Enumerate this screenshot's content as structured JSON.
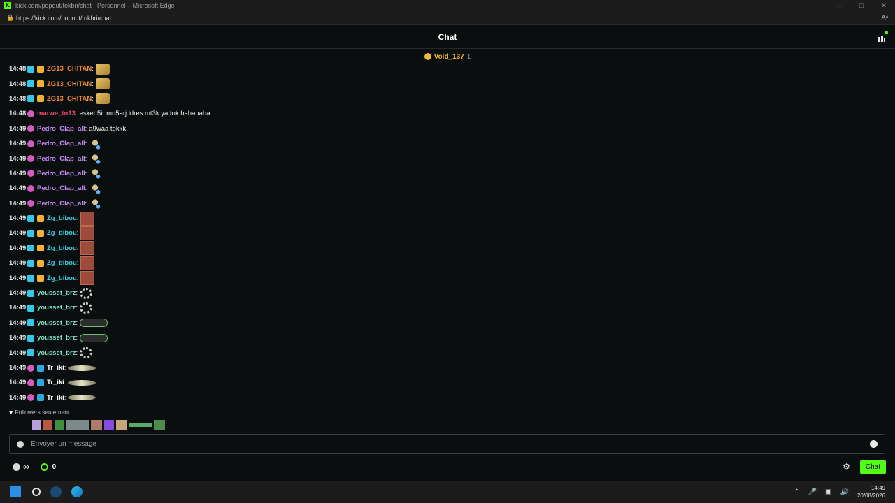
{
  "window": {
    "title": "kick.com/popout/tokbri/chat - Personnel – Microsoft Edge",
    "url": "https://kick.com/popout/tokbri/chat",
    "min": "—",
    "max": "□",
    "close": "✕",
    "read_aloud": "Aᵃ"
  },
  "header": {
    "title": "Chat"
  },
  "pinned": {
    "name": "Void_137",
    "count": "1"
  },
  "messages": [
    {
      "time": "14:48",
      "badges": [
        "sub",
        "crown"
      ],
      "user": "ZG13_CHITAN",
      "color": "#f08a3c",
      "text": "",
      "emote": "gold"
    },
    {
      "time": "14:48",
      "badges": [
        "sub",
        "crown"
      ],
      "user": "ZG13_CHITAN",
      "color": "#f08a3c",
      "text": "",
      "emote": "gold"
    },
    {
      "time": "14:48",
      "badges": [
        "sub",
        "crown"
      ],
      "user": "ZG13_CHITAN",
      "color": "#f08a3c",
      "text": "",
      "emote": "gold"
    },
    {
      "time": "14:48",
      "badges": [
        "pink"
      ],
      "user": "marwe_tn13",
      "color": "#e84a6b",
      "text": "esket 5ir mn5arj ldres mt3k ya tok hahahaha",
      "emote": ""
    },
    {
      "time": "14:49",
      "badges": [
        "pink"
      ],
      "user": "Pedro_Clap_all",
      "color": "#c58af9",
      "text": "a9waa tokkk",
      "emote": ""
    },
    {
      "time": "14:49",
      "badges": [
        "pink"
      ],
      "user": "Pedro_Clap_all",
      "color": "#c58af9",
      "text": "",
      "emote": "small"
    },
    {
      "time": "14:49",
      "badges": [
        "pink"
      ],
      "user": "Pedro_Clap_all",
      "color": "#c58af9",
      "text": "",
      "emote": "small"
    },
    {
      "time": "14:49",
      "badges": [
        "pink"
      ],
      "user": "Pedro_Clap_all",
      "color": "#c58af9",
      "text": "",
      "emote": "small"
    },
    {
      "time": "14:49",
      "badges": [
        "pink"
      ],
      "user": "Pedro_Clap_all",
      "color": "#c58af9",
      "text": "",
      "emote": "small"
    },
    {
      "time": "14:49",
      "badges": [
        "pink"
      ],
      "user": "Pedro_Clap_all",
      "color": "#c58af9",
      "text": "",
      "emote": "small"
    },
    {
      "time": "14:49",
      "badges": [
        "sub",
        "crown"
      ],
      "user": "Zg_bibou",
      "color": "#3ad1e6",
      "text": "",
      "emote": "red"
    },
    {
      "time": "14:49",
      "badges": [
        "sub",
        "crown"
      ],
      "user": "Zg_bibou",
      "color": "#3ad1e6",
      "text": "",
      "emote": "red"
    },
    {
      "time": "14:49",
      "badges": [
        "sub",
        "crown"
      ],
      "user": "Zg_bibou",
      "color": "#3ad1e6",
      "text": "",
      "emote": "red"
    },
    {
      "time": "14:49",
      "badges": [
        "sub",
        "crown"
      ],
      "user": "Zg_bibou",
      "color": "#3ad1e6",
      "text": "",
      "emote": "red"
    },
    {
      "time": "14:49",
      "badges": [
        "sub",
        "crown"
      ],
      "user": "Zg_bibou",
      "color": "#3ad1e6",
      "text": "",
      "emote": "red"
    },
    {
      "time": "14:49",
      "badges": [
        "sub"
      ],
      "user": "youssef_brz",
      "color": "#7fe0c4",
      "text": "",
      "emote": "spin"
    },
    {
      "time": "14:49",
      "badges": [
        "sub"
      ],
      "user": "youssef_brz",
      "color": "#7fe0c4",
      "text": "",
      "emote": "spin"
    },
    {
      "time": "14:49",
      "badges": [
        "sub"
      ],
      "user": "youssef_brz",
      "color": "#7fe0c4",
      "text": "",
      "emote": "eyes"
    },
    {
      "time": "14:49",
      "badges": [
        "sub"
      ],
      "user": "youssef_brz",
      "color": "#7fe0c4",
      "text": "",
      "emote": "eyes"
    },
    {
      "time": "14:49",
      "badges": [
        "sub"
      ],
      "user": "youssef_brz",
      "color": "#7fe0c4",
      "text": "",
      "emote": "spin"
    },
    {
      "time": "14:49",
      "badges": [
        "pink",
        "arrow"
      ],
      "user": "Tr_iki",
      "color": "#ffffff",
      "text": "",
      "emote": "wing"
    },
    {
      "time": "14:49",
      "badges": [
        "pink",
        "arrow"
      ],
      "user": "Tr_iki",
      "color": "#ffffff",
      "text": "",
      "emote": "wing"
    },
    {
      "time": "14:49",
      "badges": [
        "pink",
        "arrow"
      ],
      "user": "Tr_iki",
      "color": "#ffffff",
      "text": "",
      "emote": "wing"
    }
  ],
  "followers_label": "Followers seulement",
  "input": {
    "placeholder": "Envoyer un message"
  },
  "bottom": {
    "infinity": "∞",
    "points": "0",
    "chat_button": "Chat"
  },
  "tray": {
    "time": "14:49",
    "date": "20/08/2026"
  }
}
